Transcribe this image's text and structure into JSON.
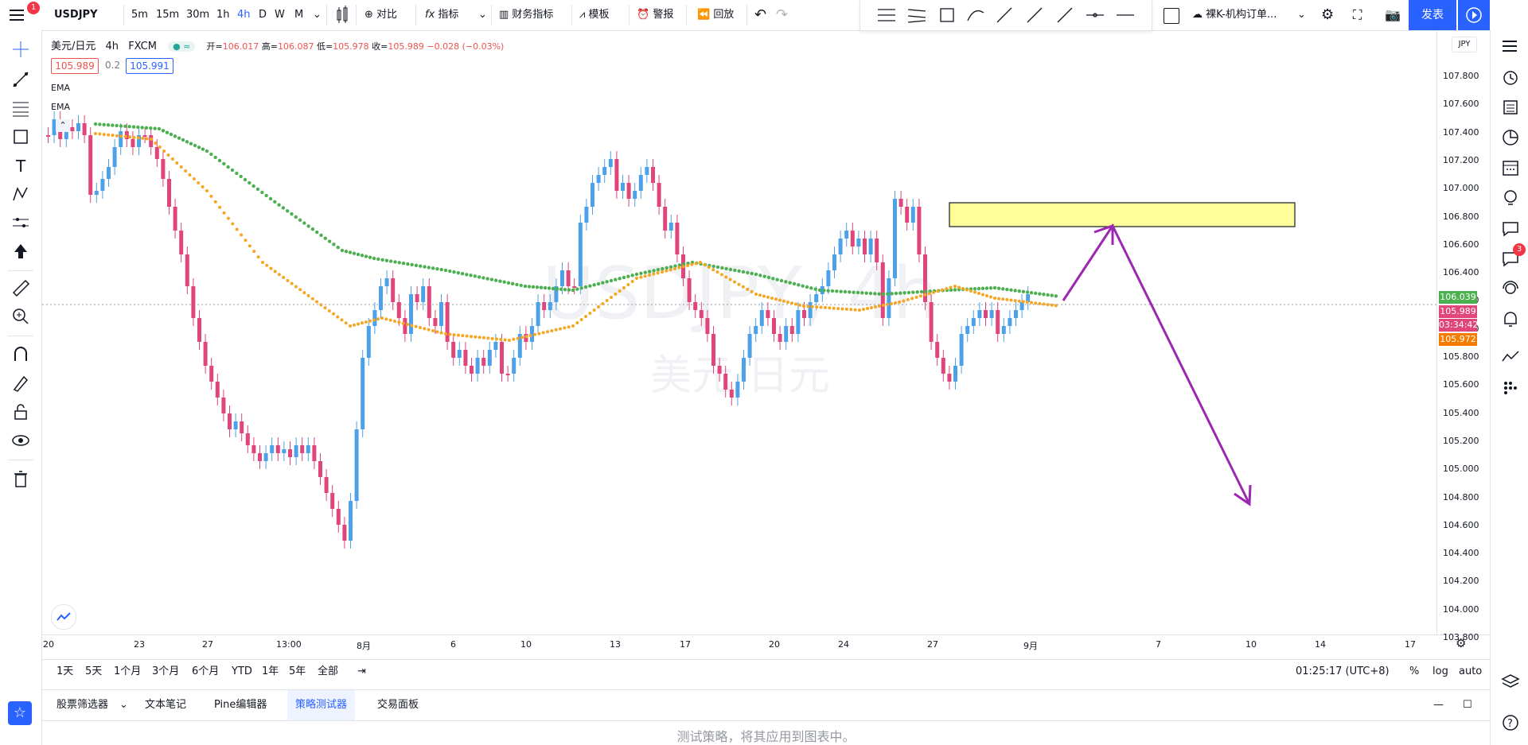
{
  "topbar": {
    "symbol": "USDJPY",
    "intervals": [
      "5m",
      "15m",
      "30m",
      "1h",
      "4h",
      "D",
      "W",
      "M"
    ],
    "compare_label": "对比",
    "indicators_label": "指标",
    "financials_label": "财务指标",
    "templates_label": "模板",
    "alert_label": "警报",
    "replay_label": "回放",
    "layout_name": "裸K-机构订单...",
    "publish_label": "发表",
    "notif_count": "1"
  },
  "legend": {
    "title": "美元/日元",
    "interval": "4h",
    "source": "FXCM",
    "open_label": "开=",
    "open": "106.017",
    "high_label": "高=",
    "high": "106.087",
    "low_label": "低=",
    "low": "105.978",
    "close_label": "收=",
    "close": "105.989",
    "change": "−0.028 (−0.03%)",
    "bid": "105.989",
    "spread": "0.2",
    "ask": "105.991",
    "ema1": "EMA",
    "ema2": "EMA"
  },
  "watermark": {
    "symbol": "USDJPY, 4h",
    "name": "美元/日元"
  },
  "price_axis": {
    "currency": "JPY",
    "ticks": [
      "107.800",
      "107.600",
      "107.400",
      "107.200",
      "107.000",
      "106.800",
      "106.600",
      "106.400",
      "106.200",
      "106.000",
      "105.800",
      "105.600",
      "105.400",
      "105.200",
      "105.000",
      "104.800",
      "104.600",
      "104.400",
      "104.200",
      "104.000",
      "103.800"
    ],
    "tag_green": "106.039",
    "tag_red": "105.989",
    "tag_countdown": "03:34:42",
    "tag_orange": "105.972"
  },
  "date_axis": [
    "20",
    "23",
    "27",
    "13:00",
    "8月",
    "6",
    "10",
    "13",
    "17",
    "20",
    "24",
    "27",
    "9月",
    "7",
    "10",
    "14",
    "17"
  ],
  "bottombar": {
    "ranges": [
      "1天",
      "5天",
      "1个月",
      "3个月",
      "6个月",
      "YTD",
      "1年",
      "5年",
      "全部"
    ],
    "clock": "01:25:17 (UTC+8)",
    "percent": "%",
    "log": "log",
    "auto": "auto"
  },
  "panel": {
    "tabs": [
      "股票筛选器",
      "文本笔记",
      "Pine编辑器",
      "策略测试器",
      "交易面板"
    ],
    "active_tab": "策略测试器",
    "message": "测试策略，将其应用到图表中。"
  },
  "rightbar": {
    "notif_count": "3"
  },
  "colors": {
    "up": "#4ca1e8",
    "down": "#e0457b",
    "ema_fast": "#f5a623",
    "ema_slow": "#4caf50",
    "box": "#ffff88",
    "arrow": "#9c27b0",
    "accent": "#2962ff"
  }
}
